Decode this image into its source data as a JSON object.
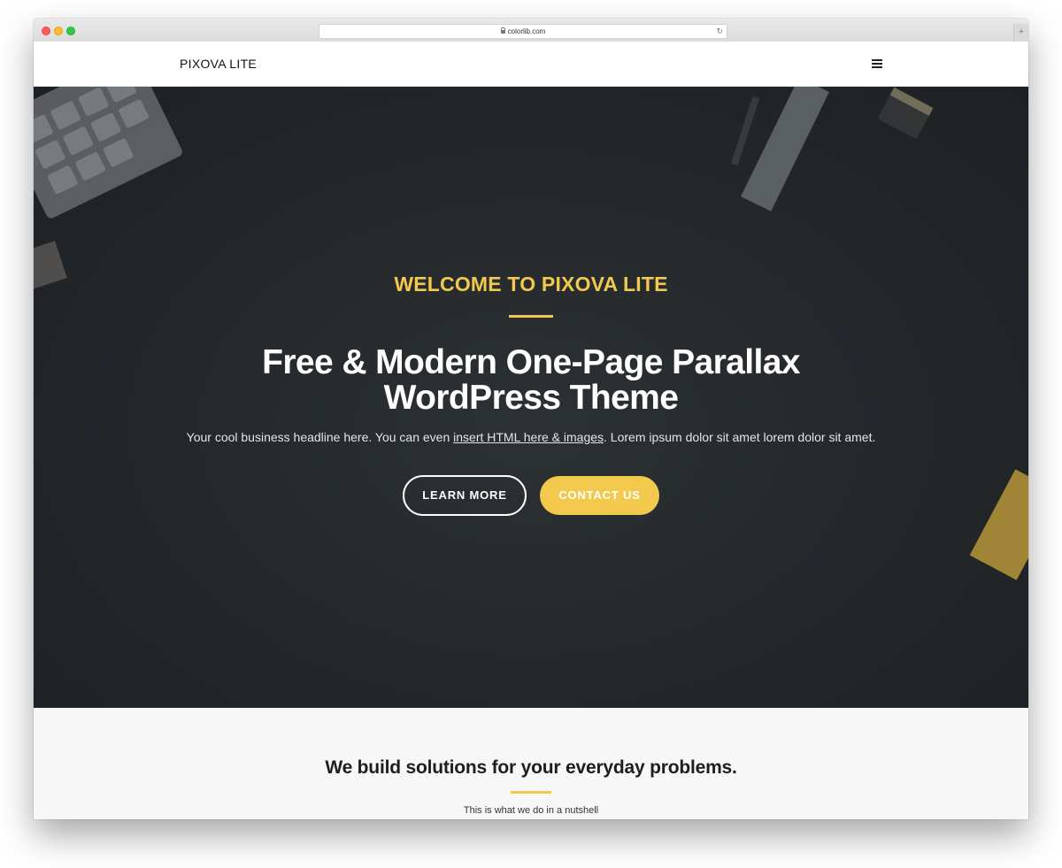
{
  "browser": {
    "url": "colorlib.com",
    "reload_icon": "reload-icon",
    "new_tab_glyph": "+"
  },
  "header": {
    "logo": "PIXOVA LITE",
    "menu_icon": "hamburger-icon"
  },
  "hero": {
    "eyebrow": "WELCOME TO PIXOVA LITE",
    "title_line1": "Free & Modern One-Page Parallax",
    "title_line2": "WordPress Theme",
    "subtitle_before": "Your cool business headline here. You can even ",
    "subtitle_link": "insert HTML here & images",
    "subtitle_after": ". Lorem ipsum dolor sit amet lorem dolor sit amet.",
    "buttons": {
      "learn_more": "LEARN MORE",
      "contact_us": "CONTACT US"
    }
  },
  "section": {
    "title": "We build solutions for your everyday problems.",
    "subtitle": "This is what we do in a nutshell"
  },
  "colors": {
    "accent": "#f2c94c",
    "hero_bg": "#25292c",
    "section_bg": "#f7f7f8"
  }
}
